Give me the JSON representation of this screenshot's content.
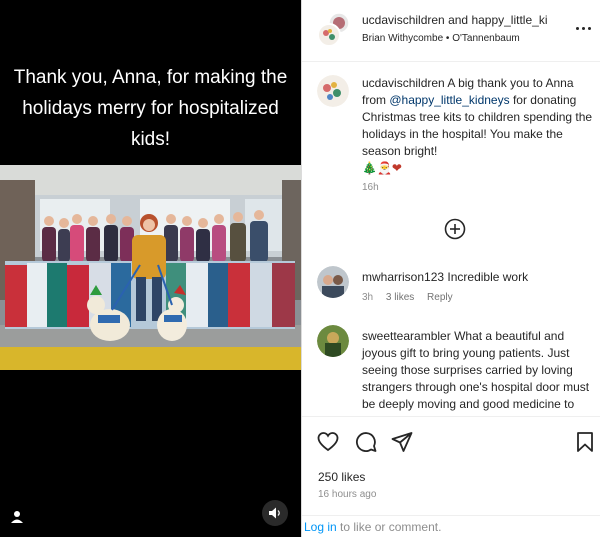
{
  "media": {
    "overlay_text": "Thank you, Anna, for making the holidays merry for hospitalized kids!",
    "photo_description_icon": "photo",
    "user_tag_icon": "user-tag-icon",
    "audio_icon": "audio-muted-icon"
  },
  "header": {
    "owner": "ucdavischildren",
    "and_word": "and",
    "collaborator": "happy_little_ki",
    "audio_artist": "Brian Withycombe",
    "separator": "•",
    "audio_title": "O'Tannenbaum",
    "more_icon": "more-horizontal-icon"
  },
  "caption": {
    "username": "ucdavischildren",
    "text_before": "A big thank you to Anna from ",
    "mention": "@happy_little_kidneys",
    "text_after": " for donating Christmas tree kits to children spending the holidays in the hospital! You make the season bright!",
    "emojis": "🎄🎅❤",
    "time": "16h"
  },
  "load_more_icon": "plus-circle-icon",
  "comments": [
    {
      "username": "mwharrison123",
      "text": "Incredible work",
      "time": "3h",
      "likes": "3 likes",
      "reply": "Reply"
    },
    {
      "username": "sweettearambler",
      "text": "What a beautiful and joyous gift to bring young patients. Just seeing those surprises carried by loving strangers through one's hospital door must be deeply moving and good medicine to each recipient. Blessings"
    }
  ],
  "actions": {
    "like_icon": "heart-icon",
    "comment_icon": "comment-icon",
    "share_icon": "share-icon",
    "save_icon": "bookmark-icon",
    "likes": "250 likes",
    "time_ago": "16 hours ago",
    "login_link": "Log in",
    "login_suffix": " to like or comment."
  }
}
